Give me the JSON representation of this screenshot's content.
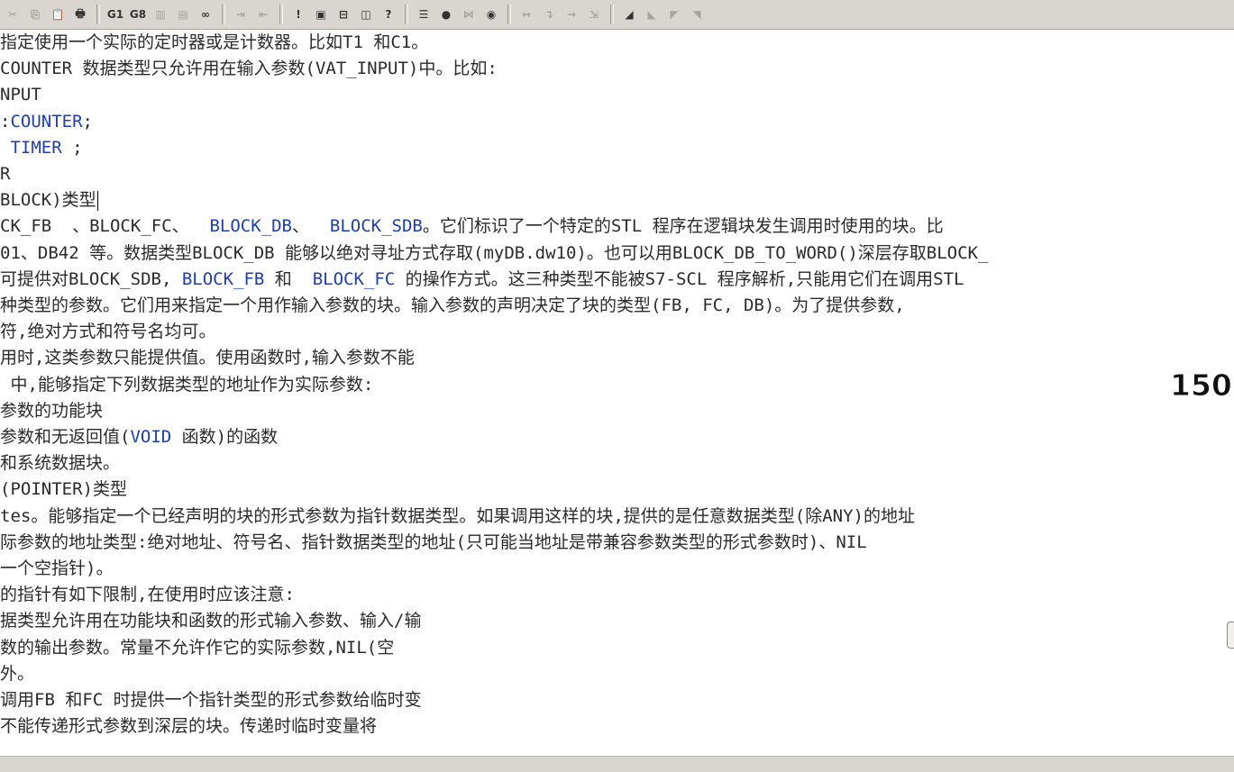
{
  "toolbar": {
    "buttons": [
      {
        "name": "cut-icon",
        "glyph": "✂",
        "enabled": false
      },
      {
        "name": "copy-icon",
        "glyph": "⎘",
        "enabled": false
      },
      {
        "name": "paste-icon",
        "glyph": "📋",
        "enabled": false
      },
      {
        "name": "print-icon",
        "glyph": "🖶",
        "enabled": true
      },
      {
        "name": "find-icon",
        "glyph": "G1",
        "enabled": true
      },
      {
        "name": "find-next-icon",
        "glyph": "G8",
        "enabled": true
      },
      {
        "name": "chart-icon",
        "glyph": "▥",
        "enabled": false
      },
      {
        "name": "chart2-icon",
        "glyph": "▤",
        "enabled": false
      },
      {
        "name": "glasses-icon",
        "glyph": "∞",
        "enabled": true
      },
      {
        "name": "go-to-icon",
        "glyph": "⇥",
        "enabled": false
      },
      {
        "name": "go-to-2-icon",
        "glyph": "⇤",
        "enabled": false
      },
      {
        "name": "exclaim-icon",
        "glyph": "!",
        "enabled": true
      },
      {
        "name": "windows-icon",
        "glyph": "▣",
        "enabled": true
      },
      {
        "name": "split-horizontal-icon",
        "glyph": "⊟",
        "enabled": true
      },
      {
        "name": "split-vertical-icon",
        "glyph": "◫",
        "enabled": true
      },
      {
        "name": "help-icon",
        "glyph": "?",
        "enabled": true
      },
      {
        "name": "list-icon",
        "glyph": "☰",
        "enabled": true
      },
      {
        "name": "breakpoint-icon",
        "glyph": "●",
        "enabled": true
      },
      {
        "name": "breakpoint-disable-icon",
        "glyph": "⋈",
        "enabled": false
      },
      {
        "name": "glasses-monitor-icon",
        "glyph": "◉",
        "enabled": true
      },
      {
        "name": "step-icon",
        "glyph": "↔",
        "enabled": false
      },
      {
        "name": "step-into-icon",
        "glyph": "↴",
        "enabled": false
      },
      {
        "name": "step-out-icon",
        "glyph": "→",
        "enabled": false
      },
      {
        "name": "run-to-cursor-icon",
        "glyph": "⇲",
        "enabled": false
      },
      {
        "name": "block-icon",
        "glyph": "◢",
        "enabled": true
      },
      {
        "name": "block-2-icon",
        "glyph": "◣",
        "enabled": false
      },
      {
        "name": "block-3-icon",
        "glyph": "◤",
        "enabled": false
      },
      {
        "name": "block-4-icon",
        "glyph": "◥",
        "enabled": false
      }
    ]
  },
  "editor": {
    "lines": [
      [
        {
          "t": "指定使用一个实际的定时器或是计数器。比如T1 和C1。"
        }
      ],
      [
        {
          "t": "COUNTER 数据类型只允许用在输入参数(VAT_INPUT)中。比如:"
        }
      ],
      [
        {
          "t": "NPUT"
        }
      ],
      [
        {
          "t": ":"
        },
        {
          "t": "COUNTER",
          "c": "kw"
        },
        {
          "t": ";"
        }
      ],
      [
        {
          "t": " "
        },
        {
          "t": "TIMER",
          "c": "kw"
        },
        {
          "t": " ;"
        }
      ],
      [
        {
          "t": "R"
        }
      ],
      [
        {
          "t": "BLOCK)类型"
        }
      ],
      [
        {
          "t": "CK_FB  、BLOCK_FC、  "
        },
        {
          "t": "BLOCK_DB",
          "c": "kw"
        },
        {
          "t": "、  "
        },
        {
          "t": "BLOCK_SDB",
          "c": "kw"
        },
        {
          "t": "。它们标识了一个特定的STL 程序在逻辑块发生调用时使用的块。比"
        }
      ],
      [
        {
          "t": "01、DB42 等。数据类型BLOCK_DB 能够以绝对寻址方式存取(myDB.dw10)。也可以用BLOCK_DB_TO_WORD()深层存取BLOCK_"
        }
      ],
      [
        {
          "t": "可提供对BLOCK_SDB, "
        },
        {
          "t": "BLOCK_FB",
          "c": "kw"
        },
        {
          "t": " 和  "
        },
        {
          "t": "BLOCK_FC",
          "c": "kw"
        },
        {
          "t": " 的操作方式。这三种类型不能被S7-SCL 程序解析,只能用它们在调用STL"
        }
      ],
      [
        {
          "t": "种类型的参数。它们用来指定一个用作输入参数的块。输入参数的声明决定了块的类型(FB, FC, DB)。为了提供参数,"
        }
      ],
      [
        {
          "t": "符,绝对方式和符号名均可。"
        }
      ],
      [
        {
          "t": "用时,这类参数只能提供值。使用函数时,输入参数不能"
        }
      ],
      [
        {
          "t": " 中,能够指定下列数据类型的地址作为实际参数:"
        }
      ],
      [
        {
          "t": "参数的功能块"
        }
      ],
      [
        {
          "t": "参数和无返回值("
        },
        {
          "t": "VOID",
          "c": "kw"
        },
        {
          "t": " 函数)的函数"
        }
      ],
      [
        {
          "t": "和系统数据块。"
        }
      ],
      [
        {
          "t": "(POINTER)类型"
        }
      ],
      [
        {
          "t": "tes。能够指定一个已经声明的块的形式参数为指针数据类型。如果调用这样的块,提供的是任意数据类型(除ANY)的地址"
        }
      ],
      [
        {
          "t": "际参数的地址类型:绝对地址、符号名、指针数据类型的地址(只可能当地址是带兼容参数类型的形式参数时)、NIL"
        }
      ],
      [
        {
          "t": "一个空指针)。"
        }
      ],
      [
        {
          "t": "的指针有如下限制,在使用时应该注意:"
        }
      ],
      [
        {
          "t": "据类型允许用在功能块和函数的形式输入参数、输入/输"
        }
      ],
      [
        {
          "t": "数的输出参数。常量不允许作它的实际参数,NIL(空"
        }
      ],
      [
        {
          "t": "外。"
        }
      ],
      [
        {
          "t": "调用FB 和FC 时提供一个指针类型的形式参数给临时变"
        }
      ],
      [
        {
          "t": "不能传递形式参数到深层的块。传递时临时变量将"
        }
      ]
    ]
  },
  "overlay": {
    "number": "150"
  },
  "colors": {
    "keyword": "#1f3fb0",
    "text": "#2b2b2b",
    "toolbar": "#d9d6d1"
  }
}
